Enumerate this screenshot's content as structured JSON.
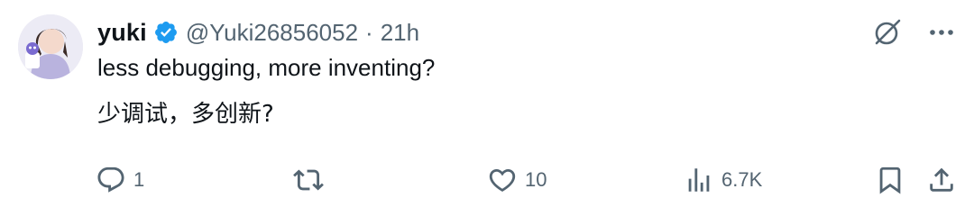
{
  "author": {
    "name": "yuki",
    "handle": "@Yuki26856052",
    "separator": "·",
    "time": "21h",
    "verified": true
  },
  "tweet": {
    "lines": [
      "less debugging, more inventing?",
      "少调试，多创新?"
    ]
  },
  "actions": {
    "replies": "1",
    "retweets": "",
    "likes": "10",
    "views": "6.7K"
  },
  "colors": {
    "text": "#0f1419",
    "secondary": "#536471",
    "verified": "#1d9bf0"
  },
  "icons": {
    "top": [
      "grok-icon",
      "more-options-icon"
    ],
    "actions": [
      "reply-icon",
      "retweet-icon",
      "like-icon",
      "views-icon",
      "bookmark-icon",
      "share-icon"
    ]
  }
}
